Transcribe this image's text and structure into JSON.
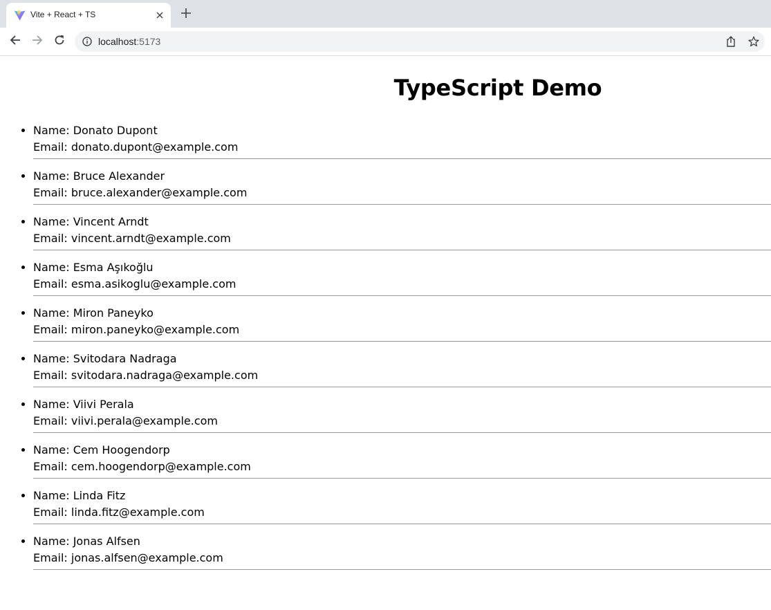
{
  "browser": {
    "tab_title": "Vite + React + TS",
    "url_host": "localhost",
    "url_port": ":5173",
    "icons": [
      "vite-favicon",
      "close-icon",
      "plus-icon",
      "back-arrow-icon",
      "forward-arrow-icon",
      "reload-icon",
      "info-icon",
      "share-icon",
      "star-icon"
    ]
  },
  "page": {
    "title": "TypeScript Demo",
    "name_prefix": "Name: ",
    "email_prefix": "Email: ",
    "users": [
      {
        "name": "Donato Dupont",
        "email": "donato.dupont@example.com"
      },
      {
        "name": "Bruce Alexander",
        "email": "bruce.alexander@example.com"
      },
      {
        "name": "Vincent Arndt",
        "email": "vincent.arndt@example.com"
      },
      {
        "name": "Esma Aşıkoğlu",
        "email": "esma.asikoglu@example.com"
      },
      {
        "name": "Miron Paneyko",
        "email": "miron.paneyko@example.com"
      },
      {
        "name": "Svitodara Nadraga",
        "email": "svitodara.nadraga@example.com"
      },
      {
        "name": "Viivi Perala",
        "email": "viivi.perala@example.com"
      },
      {
        "name": "Cem Hoogendorp",
        "email": "cem.hoogendorp@example.com"
      },
      {
        "name": "Linda Fitz",
        "email": "linda.fitz@example.com"
      },
      {
        "name": "Jonas Alfsen",
        "email": "jonas.alfsen@example.com"
      }
    ]
  }
}
